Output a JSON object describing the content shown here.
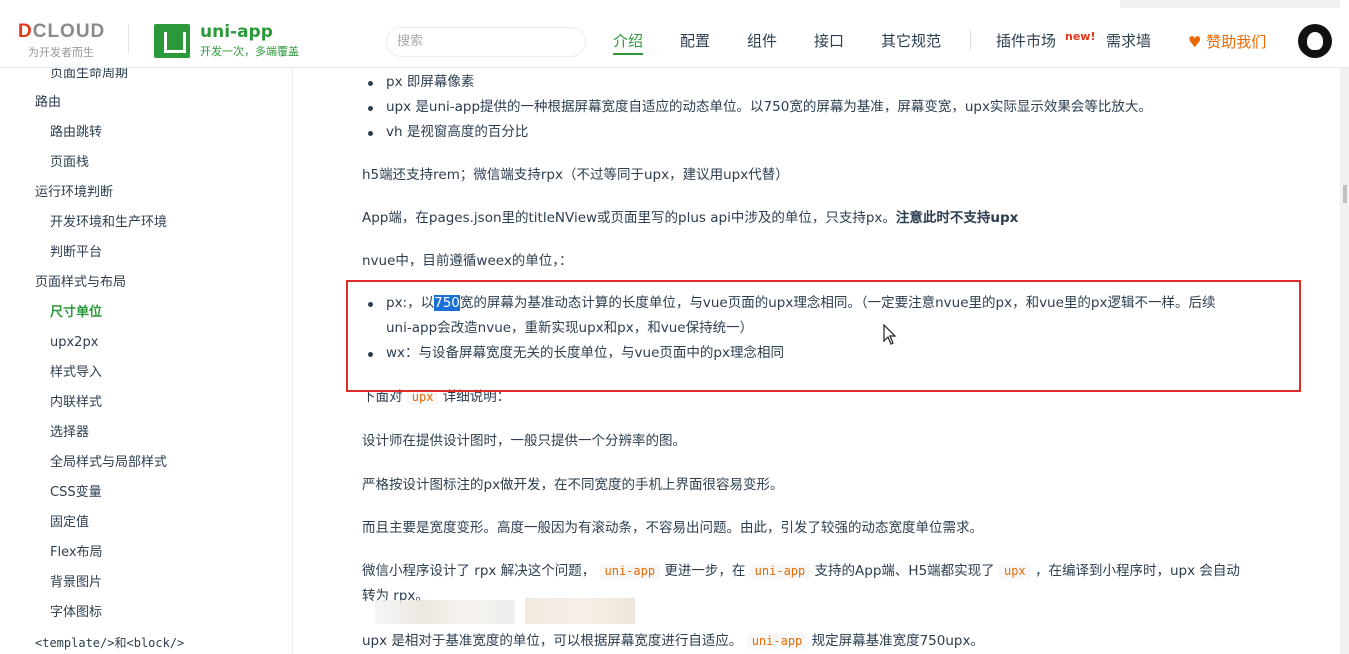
{
  "header": {
    "dcloud_logo_left": "D",
    "dcloud_logo_right": "CLOUD",
    "dcloud_sub": "为开发者而生",
    "uni_title": "uni-app",
    "uni_sub": "开发一次，多端覆盖",
    "search_placeholder": "搜索",
    "nav": [
      "介绍",
      "配置",
      "组件",
      "接口",
      "其它规范",
      "插件市场",
      "需求墙"
    ],
    "nav_active": "介绍",
    "new_badge": "new!",
    "sponsor": "♥ 赞助我们"
  },
  "sidebar": {
    "items": [
      "页面生命周期",
      "路由",
      "路由跳转",
      "页面栈",
      "运行环境判断",
      "开发环境和生产环境",
      "判断平台",
      "页面样式与布局",
      "尺寸单位",
      "upx2px",
      "样式导入",
      "内联样式",
      "选择器",
      "全局样式与局部样式",
      "CSS变量",
      "固定值",
      "Flex布局",
      "背景图片",
      "字体图标",
      "<template/>和<block/>"
    ],
    "active": "尺寸单位"
  },
  "content": {
    "b1": "px 即屏幕像素",
    "b2": "upx 是uni-app提供的一种根据屏幕宽度自适应的动态单位。以750宽的屏幕为基准，屏幕变宽，upx实际显示效果会等比放大。",
    "b3": "vh 是视窗高度的百分比",
    "p1": "h5端还支持rem；微信端支持rpx（不过等同于upx，建议用upx代替）",
    "p2_a": "App端，在pages.json里的titleNView或页面里写的plus api中涉及的单位，只支持px。",
    "p2_b": "注意此时不支持upx",
    "p3": "nvue中，目前遵循weex的单位，：",
    "n1_pre": "px:，以",
    "n1_hl": "750",
    "n1_post": "宽的屏幕为基准动态计算的长度单位，与vue页面的upx理念相同。（一定要注意nvue里的px，和vue里的px逻辑不一样。后续",
    "n1_line2": "uni-app会改造nvue，重新实现upx和px，和vue保持统一）",
    "n2": "wx：与设备屏幕宽度无关的长度单位，与vue页面中的px理念相同",
    "p4_a": "下面对",
    "p4_code": "upx",
    "p4_b": "详细说明：",
    "p5": "设计师在提供设计图时，一般只提供一个分辨率的图。",
    "p6": "严格按设计图标注的px做开发，在不同宽度的手机上界面很容易变形。",
    "p7": "而且主要是宽度变形。高度一般因为有滚动条，不容易出问题。由此，引发了较强的动态宽度单位需求。",
    "p8_a": "微信小程序设计了 rpx 解决这个问题，",
    "p8_code1": "uni-app",
    "p8_b": "更进一步，在",
    "p8_code2": "uni-app",
    "p8_c": "支持的App端、H5端都实现了",
    "p8_code3": "upx",
    "p8_d": "，在编译到小程序时，upx 会自动",
    "p8_line2": "转为 rpx。",
    "p9_a": "upx 是相对于基准宽度的单位，可以根据屏幕宽度进行自适应。",
    "p9_code": "uni-app",
    "p9_b": "规定屏幕基准宽度750upx。"
  }
}
